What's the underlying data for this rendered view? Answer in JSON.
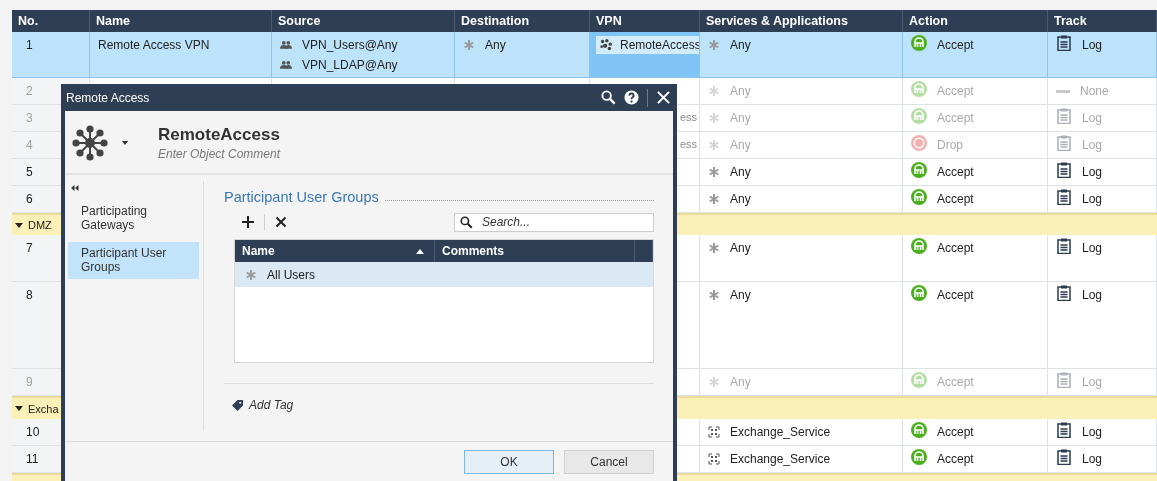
{
  "rulebase": {
    "columns": [
      "No.",
      "Name",
      "Source",
      "Destination",
      "VPN",
      "Services & Applications",
      "Action",
      "Track"
    ],
    "rows": [
      {
        "kind": "rule",
        "no": "1",
        "name": "Remote Access VPN",
        "source": [
          "VPN_Users@Any",
          "VPN_LDAP@Any"
        ],
        "destination": "Any",
        "vpn": "RemoteAccess",
        "vpn_focused": true,
        "services": {
          "kind": "any",
          "label": "Any"
        },
        "action": {
          "kind": "accept",
          "label": "Accept"
        },
        "track": {
          "kind": "log",
          "label": "Log"
        },
        "selected": true,
        "disabled": false
      },
      {
        "kind": "rule",
        "no": "2",
        "services": {
          "kind": "any",
          "label": "Any"
        },
        "action": {
          "kind": "accept",
          "label": "Accept"
        },
        "track": {
          "kind": "none",
          "label": "None"
        },
        "selected": false,
        "disabled": true
      },
      {
        "kind": "rule",
        "no": "3",
        "vpn_cut": "ess",
        "services": {
          "kind": "any",
          "label": "Any"
        },
        "action": {
          "kind": "accept",
          "label": "Accept"
        },
        "track": {
          "kind": "log",
          "label": "Log"
        },
        "selected": false,
        "disabled": true
      },
      {
        "kind": "rule",
        "no": "4",
        "vpn_cut": "ess",
        "services": {
          "kind": "any",
          "label": "Any"
        },
        "action": {
          "kind": "drop",
          "label": "Drop"
        },
        "track": {
          "kind": "log",
          "label": "Log"
        },
        "selected": false,
        "disabled": true
      },
      {
        "kind": "rule",
        "no": "5",
        "services": {
          "kind": "any",
          "label": "Any"
        },
        "action": {
          "kind": "accept",
          "label": "Accept"
        },
        "track": {
          "kind": "log",
          "label": "Log"
        },
        "selected": false,
        "disabled": false
      },
      {
        "kind": "rule",
        "no": "6",
        "services": {
          "kind": "any",
          "label": "Any"
        },
        "action": {
          "kind": "accept",
          "label": "Accept"
        },
        "track": {
          "kind": "log",
          "label": "Log"
        },
        "selected": false,
        "disabled": false
      },
      {
        "kind": "section",
        "title": "DMZ"
      },
      {
        "kind": "rule",
        "no": "7",
        "services": {
          "kind": "any",
          "label": "Any"
        },
        "action": {
          "kind": "accept",
          "label": "Accept"
        },
        "track": {
          "kind": "log",
          "label": "Log"
        },
        "selected": false,
        "disabled": false
      },
      {
        "kind": "rule",
        "no": "8",
        "services": {
          "kind": "any",
          "label": "Any"
        },
        "action": {
          "kind": "accept",
          "label": "Accept"
        },
        "track": {
          "kind": "log",
          "label": "Log"
        },
        "selected": false,
        "disabled": false
      },
      {
        "kind": "rule",
        "no": "9",
        "services": {
          "kind": "any",
          "label": "Any"
        },
        "action": {
          "kind": "accept",
          "label": "Accept"
        },
        "track": {
          "kind": "log",
          "label": "Log"
        },
        "selected": false,
        "disabled": true
      },
      {
        "kind": "section",
        "title": "Excha"
      },
      {
        "kind": "rule",
        "no": "10",
        "services": {
          "kind": "service",
          "label": "Exchange_Service"
        },
        "action": {
          "kind": "accept",
          "label": "Accept"
        },
        "track": {
          "kind": "log",
          "label": "Log"
        },
        "selected": false,
        "disabled": false
      },
      {
        "kind": "rule",
        "no": "11",
        "services": {
          "kind": "service",
          "label": "Exchange_Service"
        },
        "action": {
          "kind": "accept",
          "label": "Accept"
        },
        "track": {
          "kind": "log",
          "label": "Log"
        },
        "selected": false,
        "disabled": false
      },
      {
        "kind": "section"
      }
    ]
  },
  "dialog": {
    "title": "Remote Access",
    "object": {
      "name": "RemoteAccess",
      "comment": {
        "placeholder": "Enter Object Comment"
      }
    },
    "nav": [
      {
        "label": "Participating Gateways",
        "selected": false
      },
      {
        "label": "Participant User Groups",
        "selected": true
      }
    ],
    "section_title": "Participant User Groups",
    "search": {
      "placeholder": "Search..."
    },
    "grid": {
      "columns": [
        {
          "label": "Name",
          "sorted": true
        },
        {
          "label": "Comments",
          "sorted": false
        }
      ],
      "rows": [
        {
          "name": "All Users",
          "selected": true
        }
      ]
    },
    "add_tag": "Add Tag",
    "buttons": [
      {
        "label": "OK",
        "default": true
      },
      {
        "label": "Cancel",
        "default": false
      }
    ]
  }
}
